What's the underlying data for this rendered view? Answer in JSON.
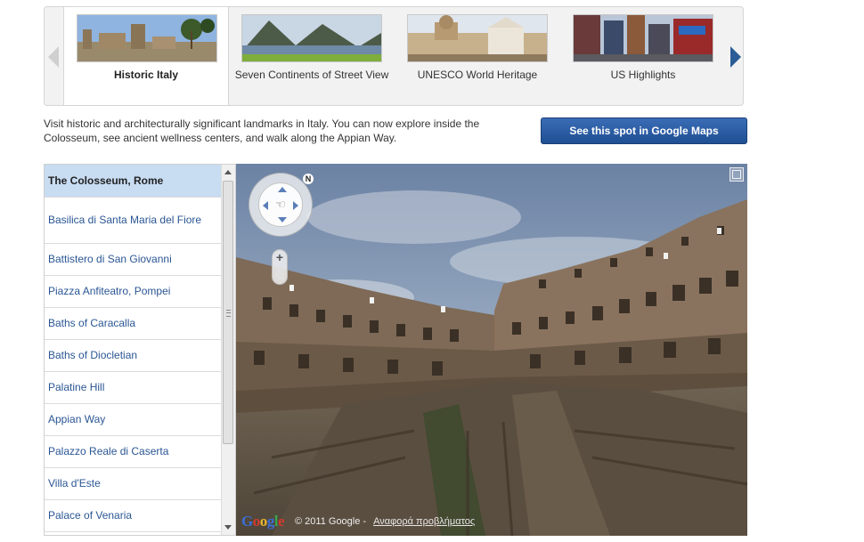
{
  "carousel": {
    "tabs": [
      {
        "label": "Historic Italy",
        "active": true
      },
      {
        "label": "Seven Continents of Street View",
        "active": false
      },
      {
        "label": "UNESCO World Heritage",
        "active": false
      },
      {
        "label": "US Highlights",
        "active": false
      }
    ]
  },
  "description": "Visit historic and architecturally significant landmarks in Italy. You can now explore inside the Colosseum, see ancient wellness centers, and walk along the Appian Way.",
  "maps_button": "See this spot in Google Maps",
  "locations": [
    {
      "label": "The Colosseum, Rome",
      "selected": true
    },
    {
      "label": "Basilica di Santa Maria del Fiore"
    },
    {
      "label": "Battistero di San Giovanni"
    },
    {
      "label": "Piazza Anfiteatro, Pompei"
    },
    {
      "label": "Baths of Caracalla"
    },
    {
      "label": "Baths of Diocletian"
    },
    {
      "label": "Palatine Hill"
    },
    {
      "label": "Appian Way"
    },
    {
      "label": "Palazzo Reale di Caserta"
    },
    {
      "label": "Villa d'Este"
    },
    {
      "label": "Palace of Venaria"
    }
  ],
  "pano": {
    "compass_north": "N",
    "zoom_in": "+",
    "logo": [
      "G",
      "o",
      "o",
      "g",
      "l",
      "e"
    ],
    "copyright": "© 2011 Google -",
    "report_link": "Αναφορά προβλήματος"
  }
}
